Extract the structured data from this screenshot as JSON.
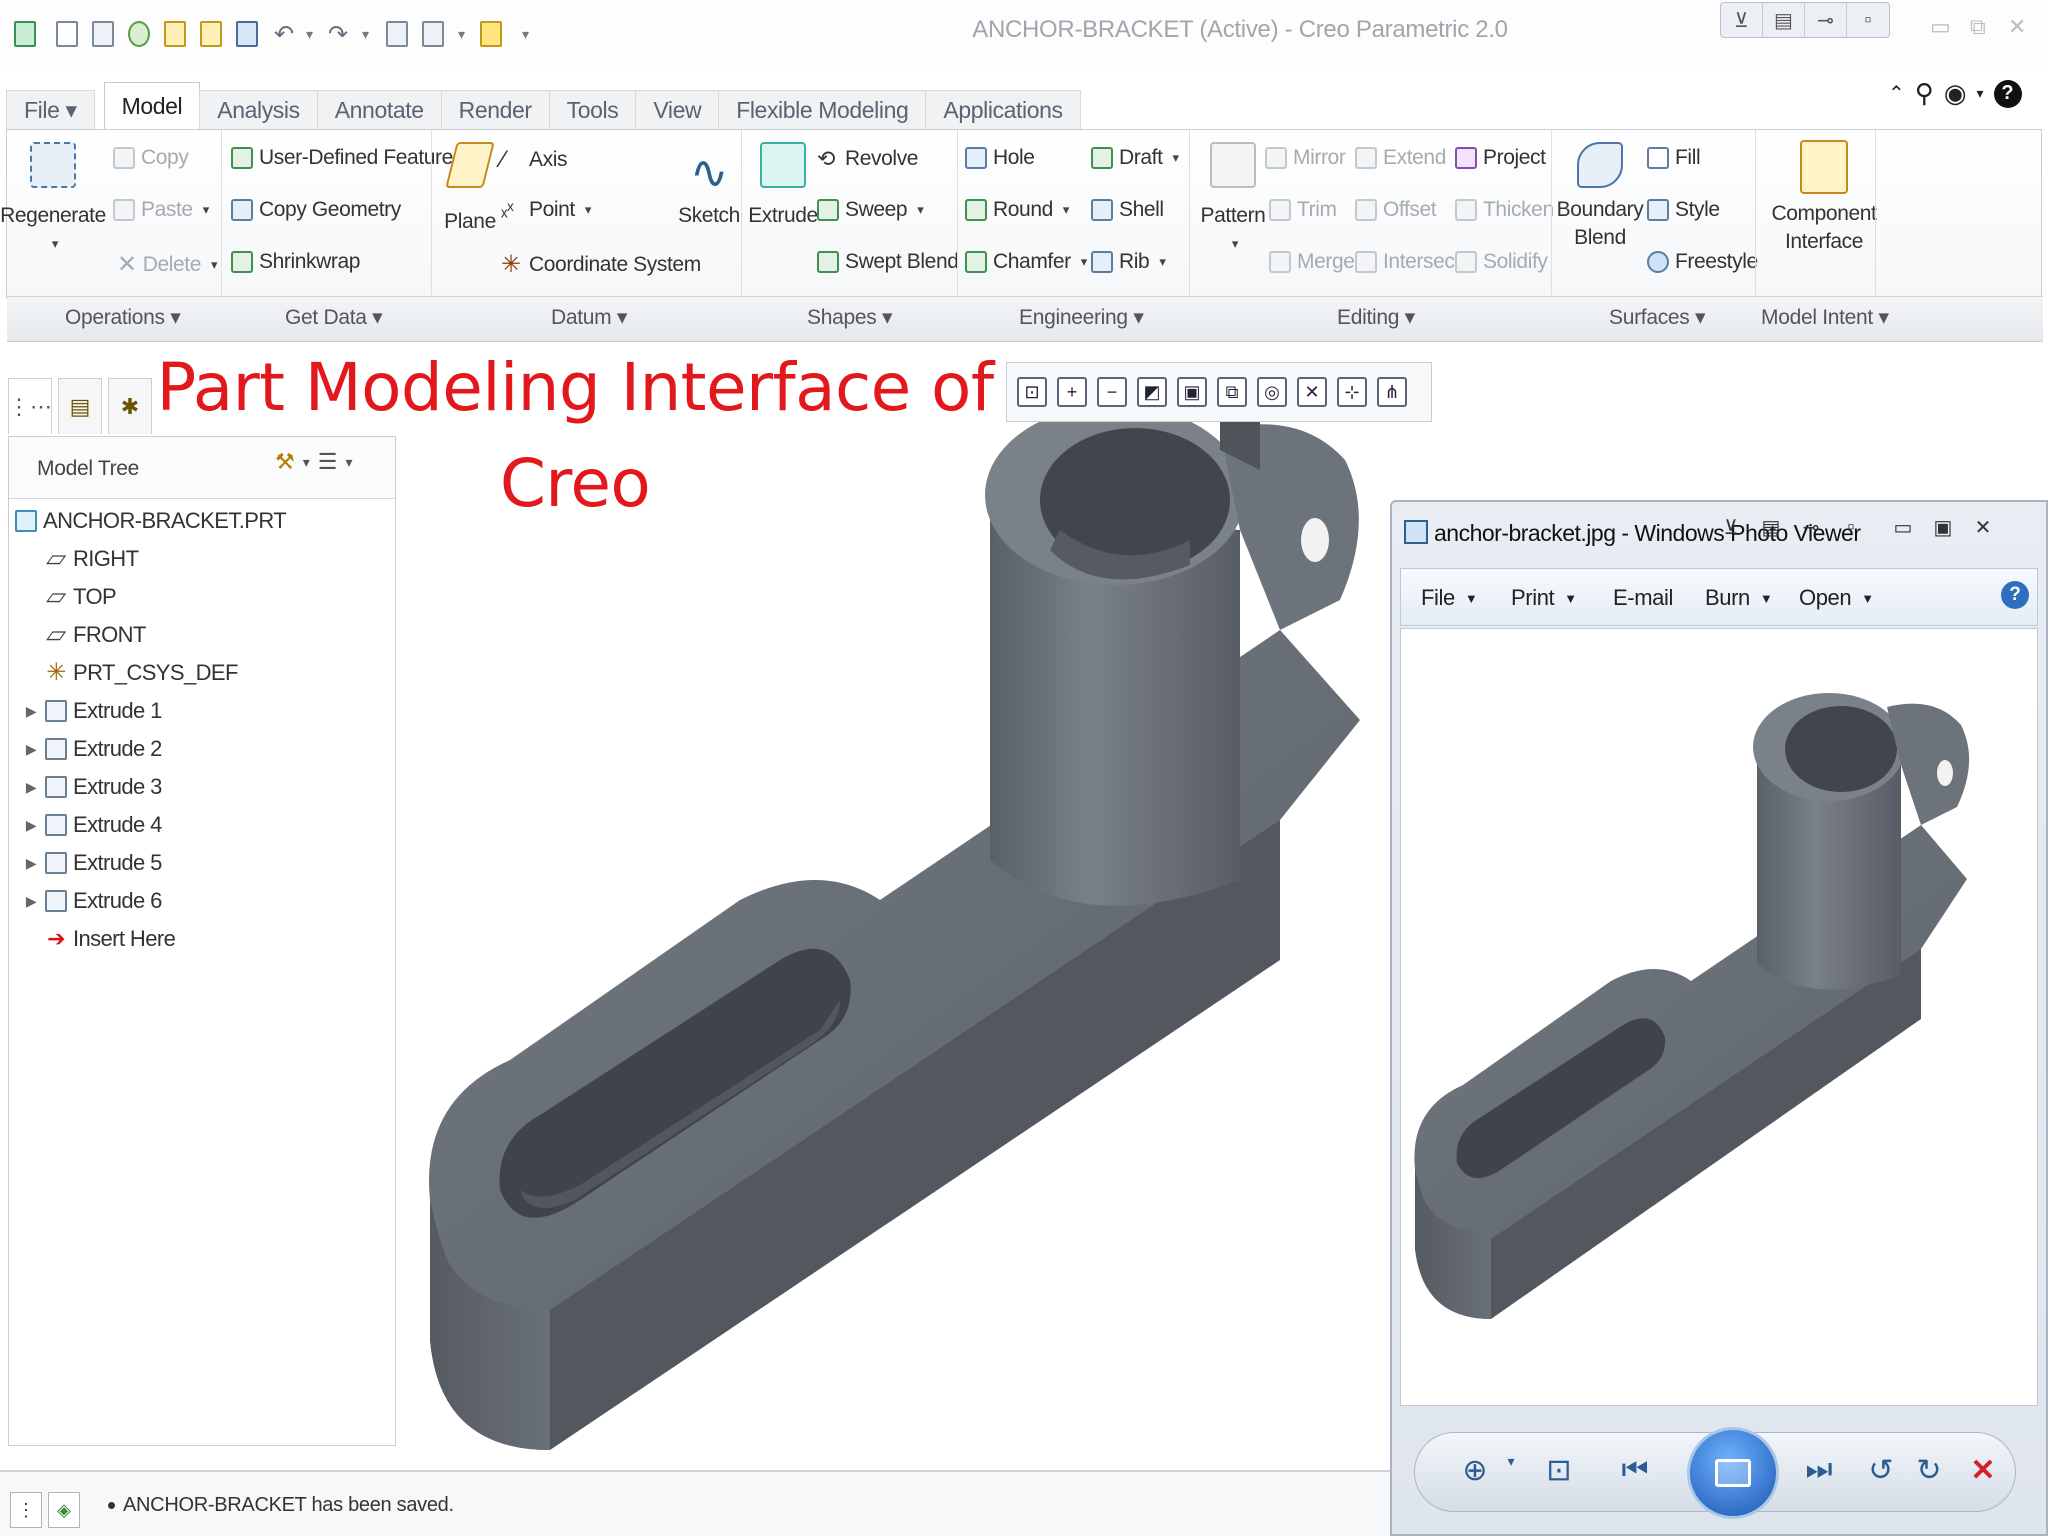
{
  "window": {
    "title": "ANCHOR-BRACKET (Active) - Creo Parametric 2.0"
  },
  "overlay_title": {
    "line1": "Part Modeling Interface of",
    "line2": "Creo"
  },
  "menu_tabs": [
    {
      "label": "File ▾"
    },
    {
      "label": "Model"
    },
    {
      "label": "Analysis"
    },
    {
      "label": "Annotate"
    },
    {
      "label": "Render"
    },
    {
      "label": "Tools"
    },
    {
      "label": "View"
    },
    {
      "label": "Flexible Modeling"
    },
    {
      "label": "Applications"
    }
  ],
  "ribbon": {
    "operations": {
      "regenerate": "Regenerate",
      "copy": "Copy",
      "paste": "Paste",
      "delete": "Delete"
    },
    "get_data": {
      "udf": "User-Defined Feature",
      "copy_geometry": "Copy Geometry",
      "shrinkwrap": "Shrinkwrap"
    },
    "datum": {
      "plane": "Plane",
      "axis": "Axis",
      "point": "Point",
      "coordinate_system": "Coordinate System",
      "sketch": "Sketch"
    },
    "shapes": {
      "extrude": "Extrude",
      "revolve": "Revolve",
      "sweep": "Sweep",
      "swept_blend": "Swept Blend"
    },
    "engineering": {
      "hole": "Hole",
      "round": "Round",
      "chamfer": "Chamfer",
      "draft": "Draft",
      "shell": "Shell",
      "rib": "Rib"
    },
    "editing": {
      "pattern": "Pattern",
      "mirror": "Mirror",
      "trim": "Trim",
      "merge": "Merge",
      "extend": "Extend",
      "offset": "Offset",
      "intersect": "Intersect",
      "project": "Project",
      "thicken": "Thicken",
      "solidify": "Solidify"
    },
    "surfaces": {
      "boundary_blend_1": "Boundary",
      "boundary_blend_2": "Blend",
      "fill": "Fill",
      "style": "Style",
      "freestyle": "Freestyle"
    },
    "model_intent": {
      "component_interface_1": "Component",
      "component_interface_2": "Interface"
    },
    "groups": [
      "Operations ▾",
      "Get Data ▾",
      "Datum ▾",
      "Shapes ▾",
      "Engineering ▾",
      "Editing ▾",
      "Surfaces ▾",
      "Model Intent ▾"
    ]
  },
  "model_tree": {
    "title": "Model Tree",
    "items": [
      {
        "label": "ANCHOR-BRACKET.PRT",
        "icon": "part-icon"
      },
      {
        "label": "RIGHT",
        "icon": "datum-plane-icon"
      },
      {
        "label": "TOP",
        "icon": "datum-plane-icon"
      },
      {
        "label": "FRONT",
        "icon": "datum-plane-icon"
      },
      {
        "label": "PRT_CSYS_DEF",
        "icon": "csys-icon"
      },
      {
        "label": "Extrude 1",
        "icon": "extrude-icon"
      },
      {
        "label": "Extrude 2",
        "icon": "extrude-icon"
      },
      {
        "label": "Extrude 3",
        "icon": "extrude-icon"
      },
      {
        "label": "Extrude 4",
        "icon": "extrude-icon"
      },
      {
        "label": "Extrude 5",
        "icon": "extrude-icon"
      },
      {
        "label": "Extrude 6",
        "icon": "extrude-icon"
      },
      {
        "label": "Insert Here",
        "icon": "insert-arrow-icon"
      }
    ]
  },
  "status": {
    "message": "ANCHOR-BRACKET has been saved."
  },
  "photo_viewer": {
    "title": "anchor-bracket.jpg - Windows Photo Viewer",
    "menu": [
      {
        "label": "File"
      },
      {
        "label": "Print"
      },
      {
        "label": "E-mail"
      },
      {
        "label": "Burn"
      },
      {
        "label": "Open"
      }
    ]
  },
  "colors": {
    "accent_red": "#e2191c",
    "model_gray": "#5f646c",
    "ribbon_border": "#c8cdd2"
  }
}
